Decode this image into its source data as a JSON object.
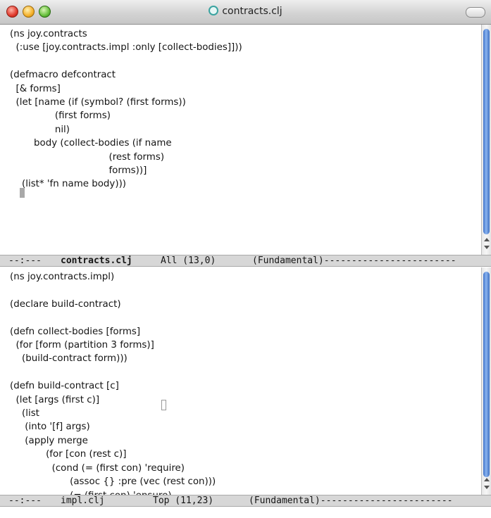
{
  "window": {
    "title": "contracts.clj",
    "icons": {
      "close": "close-traffic-light",
      "minimize": "minimize-traffic-light",
      "zoom": "zoom-traffic-light",
      "proxy": "clojure-file-icon",
      "toolbar": "toolbar-toggle-pill"
    }
  },
  "pane_top": {
    "code": "(ns joy.contracts\n  (:use [joy.contracts.impl :only [collect-bodies]]))\n\n(defmacro defcontract\n  [& forms]\n  (let [name (if (symbol? (first forms))\n               (first forms)\n               nil)\n        body (collect-bodies (if name\n                                 (rest forms)\n                                 forms))]\n    (list* 'fn name body)))",
    "modeline": {
      "status": "--:---",
      "buffer": "contracts.clj",
      "position": "All (13,0)",
      "mode": "(Fundamental)------------------------"
    }
  },
  "pane_bottom": {
    "code": "(ns joy.contracts.impl)\n\n(declare build-contract)\n\n(defn collect-bodies [forms]\n  (for [form (partition 3 forms)]\n    (build-contract form)))\n\n(defn build-contract [c]\n  (let [args (first c)]\n    (list\n     (into '[f] args)\n     (apply merge\n            (for [con (rest c)]\n              (cond (= (first con) 'require)\n                    (assoc {} :pre (vec (rest con)))\n                    (= (first con) 'ensure)",
    "modeline": {
      "status": "--:---",
      "buffer": "impl.clj",
      "position": "Top (11,23)",
      "mode": "(Fundamental)------------------------"
    }
  },
  "colors": {
    "modeline_bg": "#d7d7d7",
    "scroll_thumb": "#3d72c9",
    "cursor": "#a9a9a9"
  }
}
